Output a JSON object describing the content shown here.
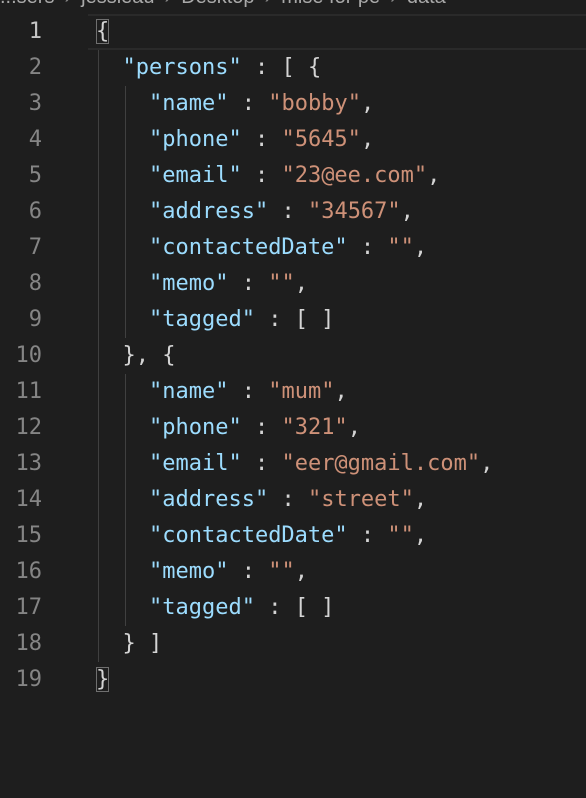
{
  "breadcrumb": [
    "...sers",
    "jessieau",
    "Desktop",
    "mise for pe",
    "data"
  ],
  "lines": [
    {
      "n": "1",
      "segs": [
        {
          "t": "{",
          "c": "p",
          "bm": true
        }
      ]
    },
    {
      "n": "2",
      "segs": [
        {
          "t": "  ",
          "c": "p"
        },
        {
          "t": "\"persons\"",
          "c": "k"
        },
        {
          "t": " : [ {",
          "c": "p"
        }
      ]
    },
    {
      "n": "3",
      "segs": [
        {
          "t": "    ",
          "c": "p"
        },
        {
          "t": "\"name\"",
          "c": "k"
        },
        {
          "t": " : ",
          "c": "p"
        },
        {
          "t": "\"bobby\"",
          "c": "s"
        },
        {
          "t": ",",
          "c": "p"
        }
      ]
    },
    {
      "n": "4",
      "segs": [
        {
          "t": "    ",
          "c": "p"
        },
        {
          "t": "\"phone\"",
          "c": "k"
        },
        {
          "t": " : ",
          "c": "p"
        },
        {
          "t": "\"5645\"",
          "c": "s"
        },
        {
          "t": ",",
          "c": "p"
        }
      ]
    },
    {
      "n": "5",
      "segs": [
        {
          "t": "    ",
          "c": "p"
        },
        {
          "t": "\"email\"",
          "c": "k"
        },
        {
          "t": " : ",
          "c": "p"
        },
        {
          "t": "\"23@ee.com\"",
          "c": "s"
        },
        {
          "t": ",",
          "c": "p"
        }
      ]
    },
    {
      "n": "6",
      "segs": [
        {
          "t": "    ",
          "c": "p"
        },
        {
          "t": "\"address\"",
          "c": "k"
        },
        {
          "t": " : ",
          "c": "p"
        },
        {
          "t": "\"34567\"",
          "c": "s"
        },
        {
          "t": ",",
          "c": "p"
        }
      ]
    },
    {
      "n": "7",
      "segs": [
        {
          "t": "    ",
          "c": "p"
        },
        {
          "t": "\"contactedDate\"",
          "c": "k"
        },
        {
          "t": " : ",
          "c": "p"
        },
        {
          "t": "\"\"",
          "c": "s"
        },
        {
          "t": ",",
          "c": "p"
        }
      ]
    },
    {
      "n": "8",
      "segs": [
        {
          "t": "    ",
          "c": "p"
        },
        {
          "t": "\"memo\"",
          "c": "k"
        },
        {
          "t": " : ",
          "c": "p"
        },
        {
          "t": "\"\"",
          "c": "s"
        },
        {
          "t": ",",
          "c": "p"
        }
      ]
    },
    {
      "n": "9",
      "segs": [
        {
          "t": "    ",
          "c": "p"
        },
        {
          "t": "\"tagged\"",
          "c": "k"
        },
        {
          "t": " : [ ]",
          "c": "p"
        }
      ]
    },
    {
      "n": "10",
      "segs": [
        {
          "t": "  }, {",
          "c": "p"
        }
      ]
    },
    {
      "n": "11",
      "segs": [
        {
          "t": "    ",
          "c": "p"
        },
        {
          "t": "\"name\"",
          "c": "k"
        },
        {
          "t": " : ",
          "c": "p"
        },
        {
          "t": "\"mum\"",
          "c": "s"
        },
        {
          "t": ",",
          "c": "p"
        }
      ]
    },
    {
      "n": "12",
      "segs": [
        {
          "t": "    ",
          "c": "p"
        },
        {
          "t": "\"phone\"",
          "c": "k"
        },
        {
          "t": " : ",
          "c": "p"
        },
        {
          "t": "\"321\"",
          "c": "s"
        },
        {
          "t": ",",
          "c": "p"
        }
      ]
    },
    {
      "n": "13",
      "segs": [
        {
          "t": "    ",
          "c": "p"
        },
        {
          "t": "\"email\"",
          "c": "k"
        },
        {
          "t": " : ",
          "c": "p"
        },
        {
          "t": "\"eer@gmail.com\"",
          "c": "s"
        },
        {
          "t": ",",
          "c": "p"
        }
      ]
    },
    {
      "n": "14",
      "segs": [
        {
          "t": "    ",
          "c": "p"
        },
        {
          "t": "\"address\"",
          "c": "k"
        },
        {
          "t": " : ",
          "c": "p"
        },
        {
          "t": "\"street\"",
          "c": "s"
        },
        {
          "t": ",",
          "c": "p"
        }
      ]
    },
    {
      "n": "15",
      "segs": [
        {
          "t": "    ",
          "c": "p"
        },
        {
          "t": "\"contactedDate\"",
          "c": "k"
        },
        {
          "t": " : ",
          "c": "p"
        },
        {
          "t": "\"\"",
          "c": "s"
        },
        {
          "t": ",",
          "c": "p"
        }
      ]
    },
    {
      "n": "16",
      "segs": [
        {
          "t": "    ",
          "c": "p"
        },
        {
          "t": "\"memo\"",
          "c": "k"
        },
        {
          "t": " : ",
          "c": "p"
        },
        {
          "t": "\"\"",
          "c": "s"
        },
        {
          "t": ",",
          "c": "p"
        }
      ]
    },
    {
      "n": "17",
      "segs": [
        {
          "t": "    ",
          "c": "p"
        },
        {
          "t": "\"tagged\"",
          "c": "k"
        },
        {
          "t": " : [ ]",
          "c": "p"
        }
      ]
    },
    {
      "n": "18",
      "segs": [
        {
          "t": "  } ]",
          "c": "p"
        }
      ]
    },
    {
      "n": "19",
      "segs": [
        {
          "t": "}",
          "c": "p",
          "bm": true
        }
      ]
    }
  ],
  "active_line": "1",
  "colors": {
    "background": "#1e1e1e",
    "key": "#9cdcfe",
    "string": "#ce9178",
    "punctuation": "#d4d4d4",
    "line_number": "#858585"
  }
}
